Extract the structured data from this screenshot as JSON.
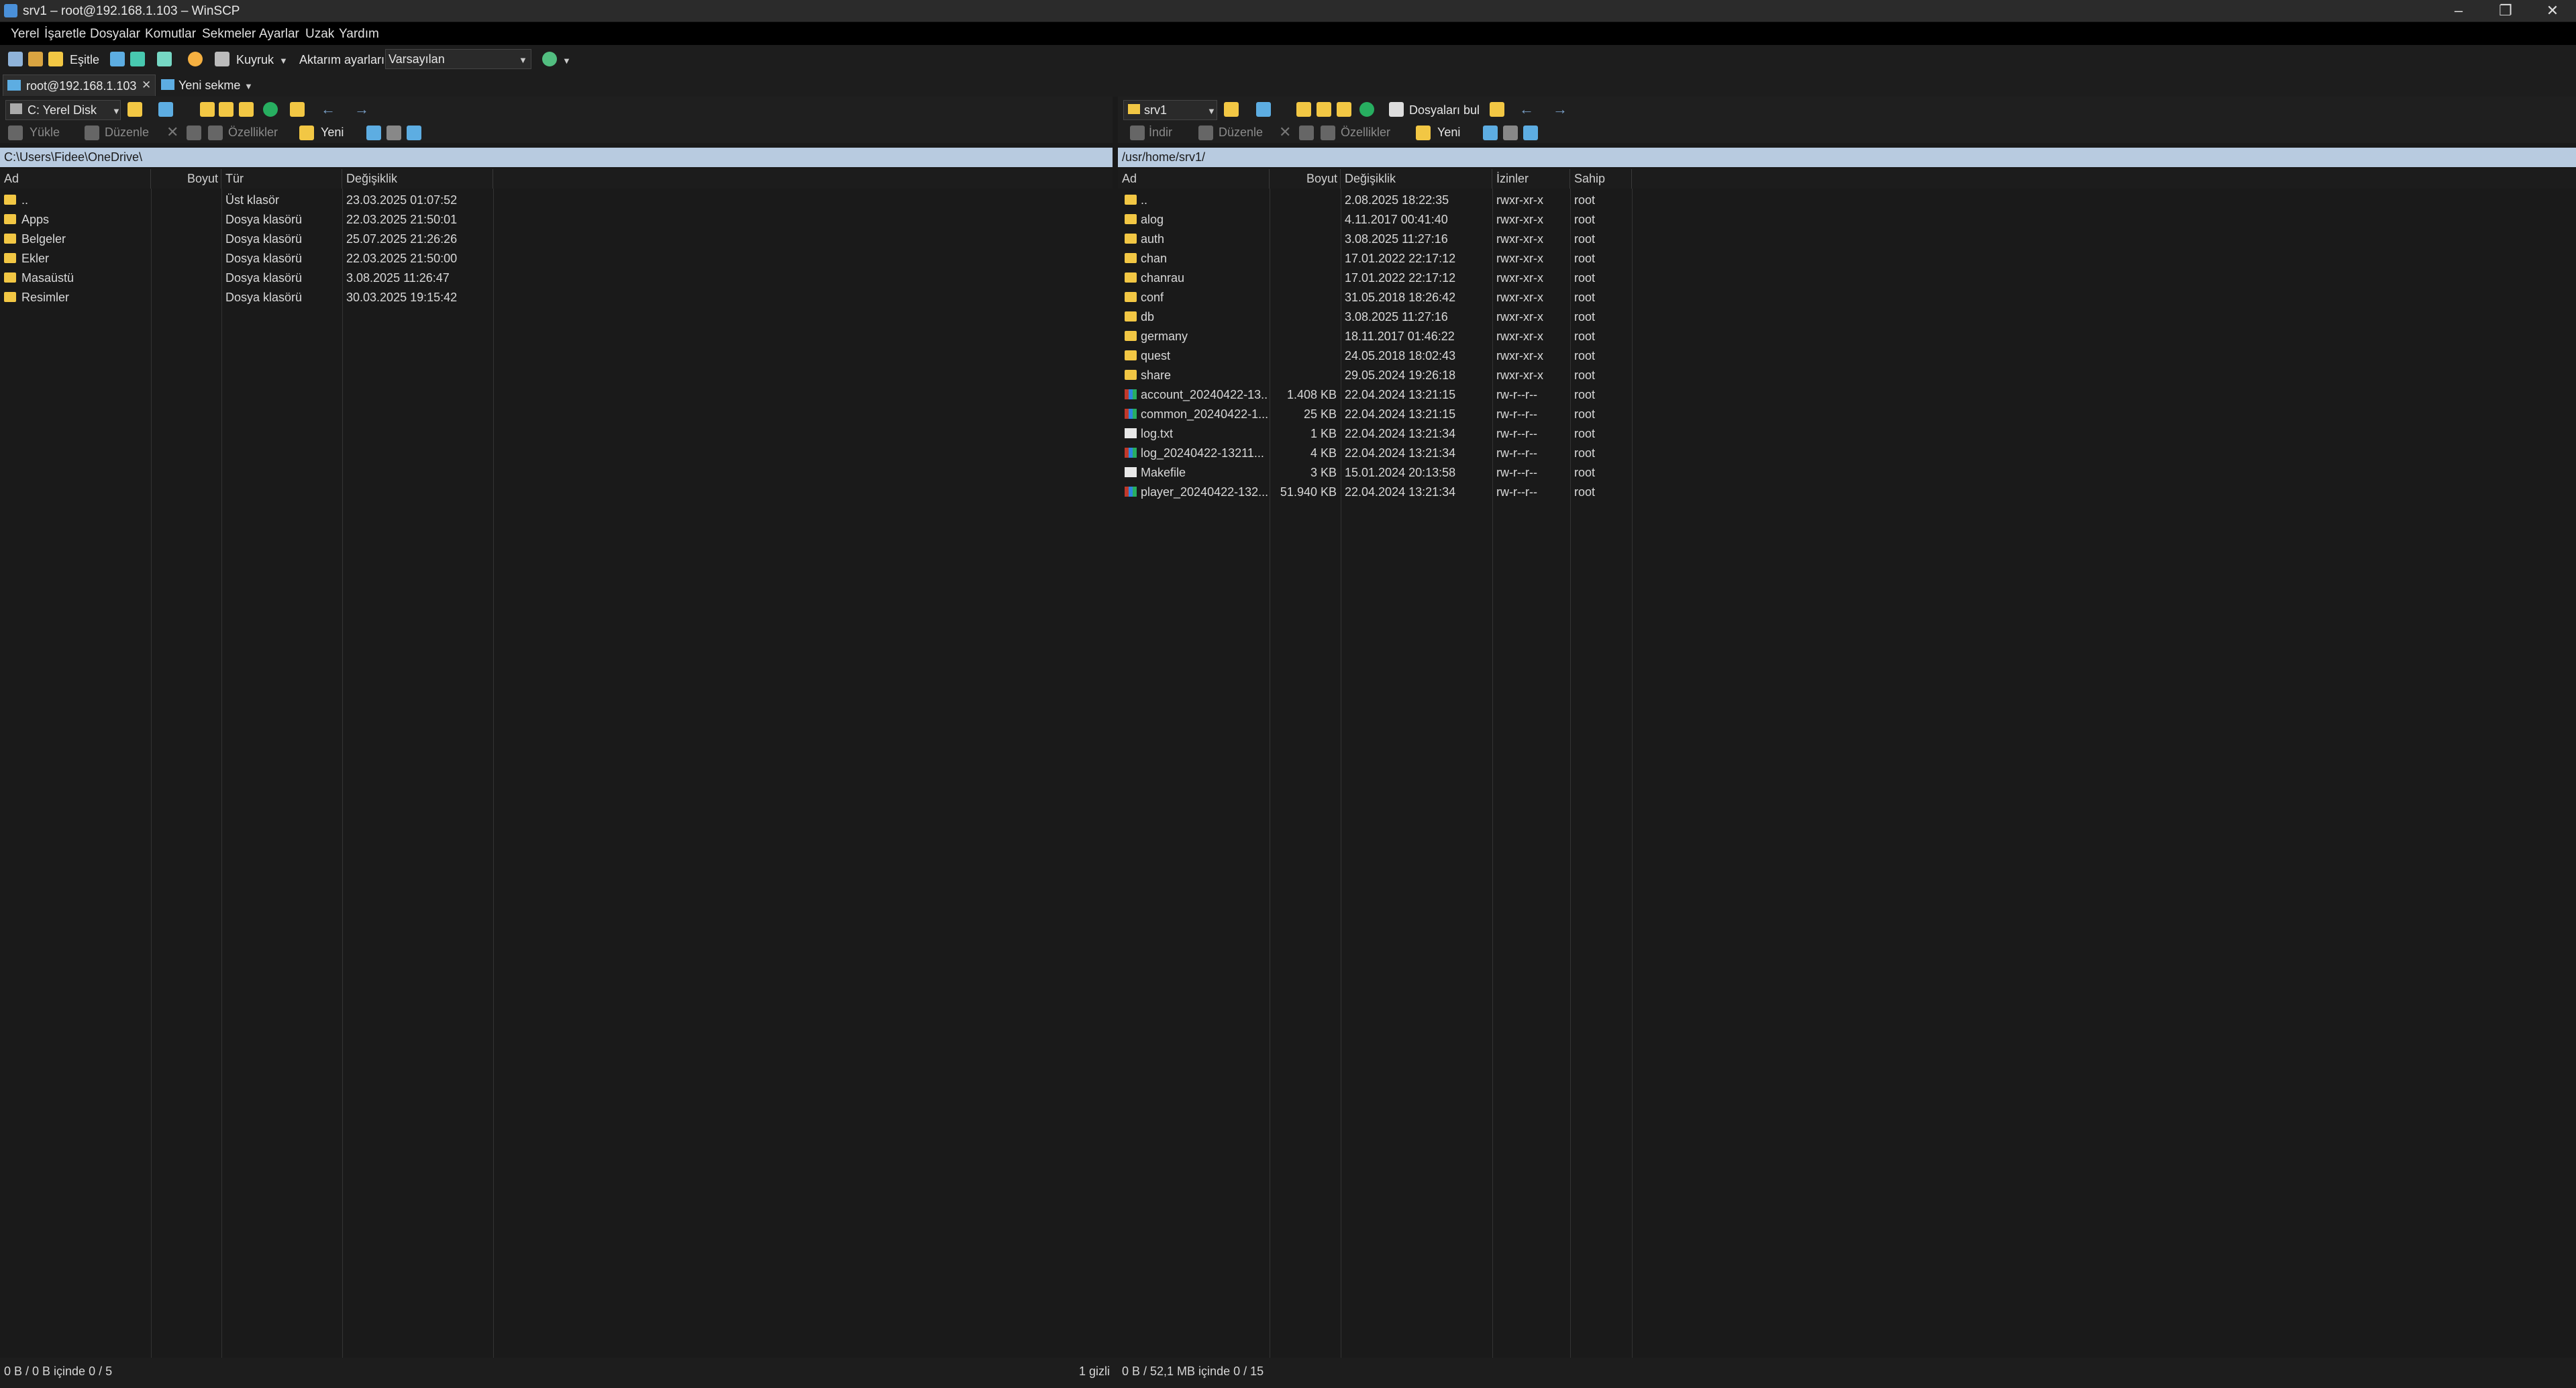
{
  "window": {
    "title": "srv1 – root@192.168.1.103 – WinSCP",
    "minimize": "–",
    "maximize": "❐",
    "close": "✕"
  },
  "menu": [
    "Yerel",
    "İşaretle",
    "Dosyalar",
    "Komutlar",
    "Sekmeler",
    "Ayarlar",
    "Uzak",
    "Yardım"
  ],
  "toolbar": {
    "sync_label": "Eşitle",
    "queue_label": "Kuyruk",
    "transfer_settings_label": "Aktarım ayarları",
    "transfer_settings_value": "Varsayılan"
  },
  "tabs": {
    "session": "root@192.168.1.103",
    "new_tab": "Yeni sekme"
  },
  "left": {
    "drive": "C: Yerel Disk",
    "upload_label": "Yükle",
    "edit_label": "Düzenle",
    "properties_label": "Özellikler",
    "new_label": "Yeni",
    "path": "C:\\Users\\Fidee\\OneDrive\\",
    "columns": [
      "Ad",
      "Boyut",
      "Tür",
      "Değişiklik"
    ],
    "rows": [
      {
        "name": "..",
        "size": "",
        "type": "Üst klasör",
        "modified": "23.03.2025 01:07:52",
        "icon": "parent-folder"
      },
      {
        "name": "Apps",
        "size": "",
        "type": "Dosya klasörü",
        "modified": "22.03.2025 21:50:01",
        "icon": "folder"
      },
      {
        "name": "Belgeler",
        "size": "",
        "type": "Dosya klasörü",
        "modified": "25.07.2025 21:26:26",
        "icon": "documents-folder"
      },
      {
        "name": "Ekler",
        "size": "",
        "type": "Dosya klasörü",
        "modified": "22.03.2025 21:50:00",
        "icon": "folder"
      },
      {
        "name": "Masaüstü",
        "size": "",
        "type": "Dosya klasörü",
        "modified": "3.08.2025 11:26:47",
        "icon": "desktop-folder"
      },
      {
        "name": "Resimler",
        "size": "",
        "type": "Dosya klasörü",
        "modified": "30.03.2025 19:15:42",
        "icon": "pictures-folder"
      }
    ],
    "status_left": "0 B / 0 B içinde 0 / 5",
    "status_right": "1 gizli"
  },
  "right": {
    "drive": "srv1",
    "download_label": "İndir",
    "edit_label": "Düzenle",
    "properties_label": "Özellikler",
    "new_label": "Yeni",
    "find_label": "Dosyaları bul",
    "path": "/usr/home/srv1/",
    "columns": [
      "Ad",
      "Boyut",
      "Değişiklik",
      "İzinler",
      "Sahip"
    ],
    "rows": [
      {
        "name": "..",
        "size": "",
        "modified": "2.08.2025 18:22:35",
        "perm": "rwxr-xr-x",
        "owner": "root",
        "icon": "parent-folder"
      },
      {
        "name": "alog",
        "size": "",
        "modified": "4.11.2017 00:41:40",
        "perm": "rwxr-xr-x",
        "owner": "root",
        "icon": "folder"
      },
      {
        "name": "auth",
        "size": "",
        "modified": "3.08.2025 11:27:16",
        "perm": "rwxr-xr-x",
        "owner": "root",
        "icon": "folder"
      },
      {
        "name": "chan",
        "size": "",
        "modified": "17.01.2022 22:17:12",
        "perm": "rwxr-xr-x",
        "owner": "root",
        "icon": "folder"
      },
      {
        "name": "chanrau",
        "size": "",
        "modified": "17.01.2022 22:17:12",
        "perm": "rwxr-xr-x",
        "owner": "root",
        "icon": "folder"
      },
      {
        "name": "conf",
        "size": "",
        "modified": "31.05.2018 18:26:42",
        "perm": "rwxr-xr-x",
        "owner": "root",
        "icon": "link-folder"
      },
      {
        "name": "db",
        "size": "",
        "modified": "3.08.2025 11:27:16",
        "perm": "rwxr-xr-x",
        "owner": "root",
        "icon": "folder"
      },
      {
        "name": "germany",
        "size": "",
        "modified": "18.11.2017 01:46:22",
        "perm": "rwxr-xr-x",
        "owner": "root",
        "icon": "link-folder"
      },
      {
        "name": "quest",
        "size": "",
        "modified": "24.05.2018 18:02:43",
        "perm": "rwxr-xr-x",
        "owner": "root",
        "icon": "link-folder"
      },
      {
        "name": "share",
        "size": "",
        "modified": "29.05.2024 19:26:18",
        "perm": "rwxr-xr-x",
        "owner": "root",
        "icon": "folder"
      },
      {
        "name": "account_20240422-13...",
        "size": "1.408 KB",
        "modified": "22.04.2024 13:21:15",
        "perm": "rw-r--r--",
        "owner": "root",
        "icon": "archive"
      },
      {
        "name": "common_20240422-1...",
        "size": "25 KB",
        "modified": "22.04.2024 13:21:15",
        "perm": "rw-r--r--",
        "owner": "root",
        "icon": "archive"
      },
      {
        "name": "log.txt",
        "size": "1 KB",
        "modified": "22.04.2024 13:21:34",
        "perm": "rw-r--r--",
        "owner": "root",
        "icon": "file"
      },
      {
        "name": "log_20240422-13211...",
        "size": "4 KB",
        "modified": "22.04.2024 13:21:34",
        "perm": "rw-r--r--",
        "owner": "root",
        "icon": "archive"
      },
      {
        "name": "Makefile",
        "size": "3 KB",
        "modified": "15.01.2024 20:13:58",
        "perm": "rw-r--r--",
        "owner": "root",
        "icon": "file"
      },
      {
        "name": "player_20240422-132...",
        "size": "51.940 KB",
        "modified": "22.04.2024 13:21:34",
        "perm": "rw-r--r--",
        "owner": "root",
        "icon": "archive"
      }
    ],
    "status": "0 B / 52,1 MB içinde 0 / 15"
  }
}
